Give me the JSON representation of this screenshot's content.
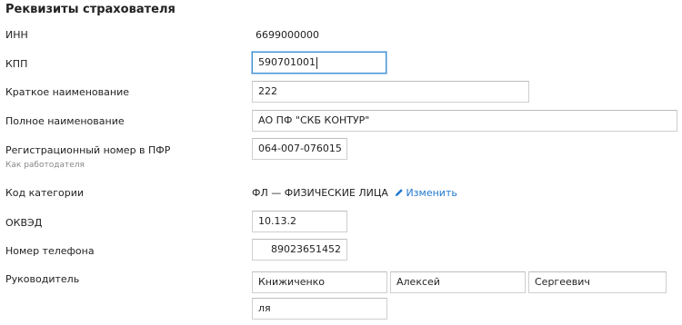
{
  "section": {
    "title": "Реквизиты страхователя"
  },
  "fields": {
    "inn": {
      "label": "ИНН",
      "value": "6699000000"
    },
    "kpp": {
      "label": "КПП",
      "value": "590701001"
    },
    "short_name": {
      "label": "Краткое наименование",
      "value": "222"
    },
    "full_name": {
      "label": "Полное наименование",
      "value": "АО ПФ \"СКБ КОНТУР\""
    },
    "pfr_number": {
      "label": "Регистрационный номер в ПФР",
      "sublabel": "Как работодателя",
      "value": "064-007-076015"
    },
    "category": {
      "label": "Код категории",
      "code": "ФЛ",
      "separator": "—",
      "name": "ФИЗИЧЕСКИЕ ЛИЦА",
      "change_link": "Изменить",
      "link_color": "#1f78d1"
    },
    "okved": {
      "label": "ОКВЭД",
      "value": "10.13.2"
    },
    "phone": {
      "label": "Номер телефона",
      "value": "89023651452"
    },
    "manager": {
      "label": "Руководитель",
      "last_name": "Книжиченко",
      "first_name": "Алексей",
      "middle_name": "Сергеевич",
      "position": "ля"
    }
  },
  "colors": {
    "focus_border": "#3d8fd1",
    "input_border": "#cfcfcf"
  }
}
